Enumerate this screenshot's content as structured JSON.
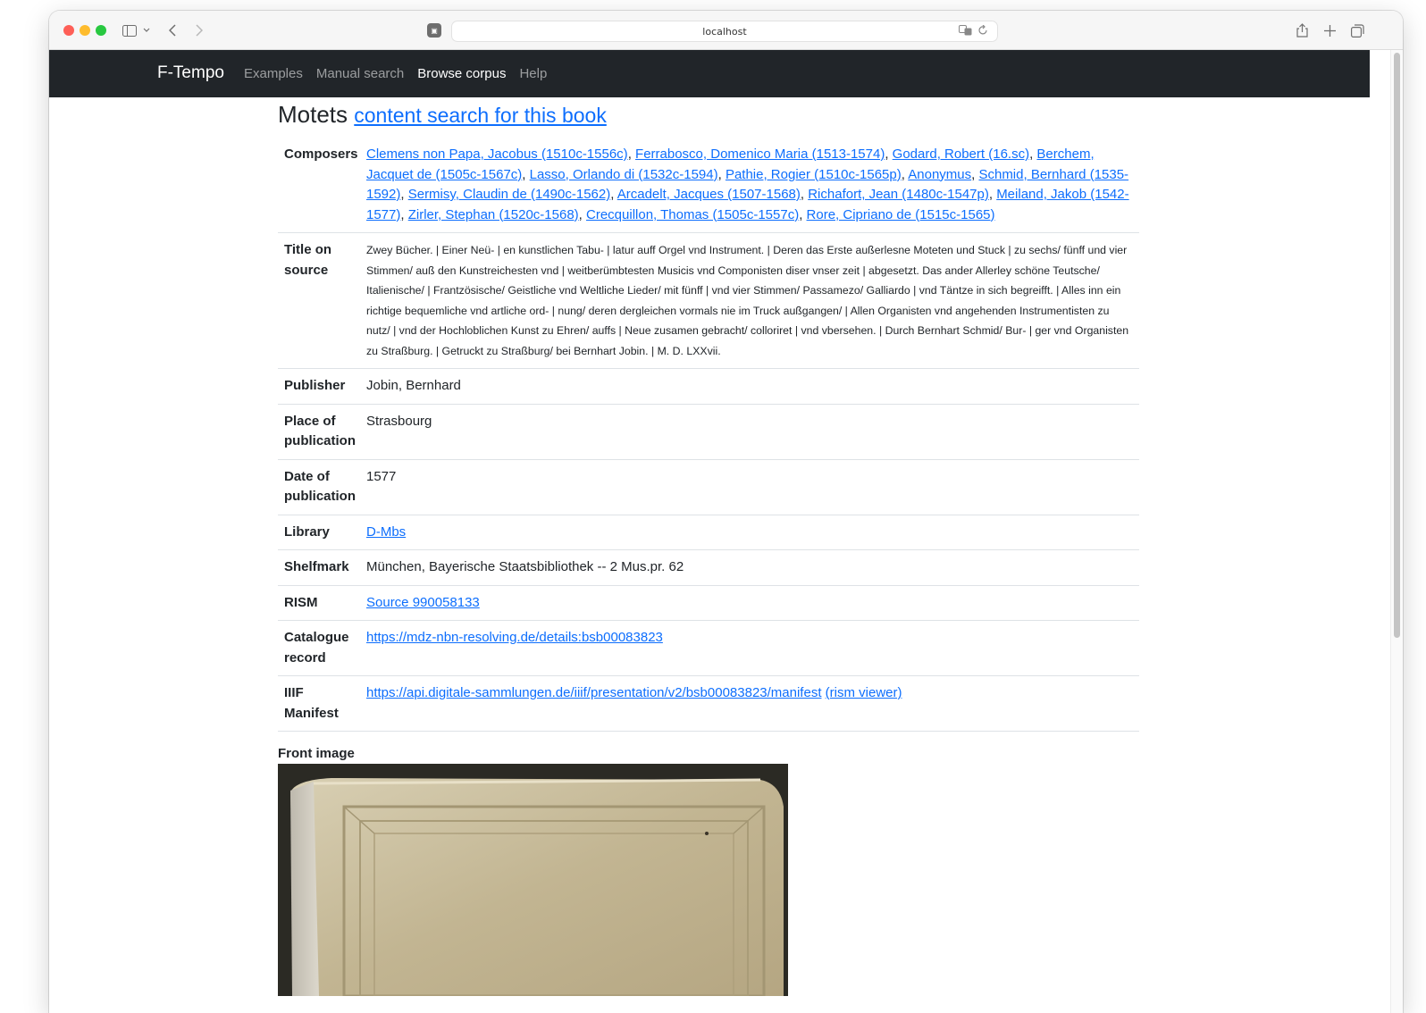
{
  "browser": {
    "address": "localhost"
  },
  "navbar": {
    "brand": "F-Tempo",
    "links": [
      "Examples",
      "Manual search",
      "Browse corpus",
      "Help"
    ]
  },
  "page": {
    "title": "Motets",
    "title_link": "content search for this book"
  },
  "details": {
    "composers_label": "Composers",
    "composers": [
      "Clemens non Papa, Jacobus (1510c-1556c)",
      "Ferrabosco, Domenico Maria (1513-1574)",
      "Godard, Robert (16.sc)",
      "Berchem, Jacquet de (1505c-1567c)",
      "Lasso, Orlando di (1532c-1594)",
      "Pathie, Rogier (1510c-1565p)",
      "Anonymus",
      "Schmid, Bernhard (1535-1592)",
      "Sermisy, Claudin de (1490c-1562)",
      "Arcadelt, Jacques (1507-1568)",
      "Richafort, Jean (1480c-1547p)",
      "Meiland, Jakob (1542-1577)",
      "Zirler, Stephan (1520c-1568)",
      "Crecquillon, Thomas (1505c-1557c)",
      "Rore, Cipriano de (1515c-1565)"
    ],
    "title_on_source_label": "Title on source",
    "title_on_source": "Zwey Bücher. | Einer Neü- | en kunstlichen Tabu- | latur auff Orgel vnd Instrument. | Deren das Erste außerlesne Moteten und Stuck | zu sechs/ fünff und vier Stimmen/ auß den Kunstreichesten vnd | weitberümbtesten Musicis vnd Componisten diser vnser zeit | abgesetzt. Das ander Allerley schöne Teutsche/ Italienische/ | Frantzösische/ Geistliche vnd Weltliche Lieder/ mit fünff | vnd vier Stimmen/ Passamezo/ Galliardo | vnd Täntze in sich begreifft. | Alles inn ein richtige bequemliche vnd artliche ord- | nung/ deren dergleichen vormals nie im Truck außgangen/ | Allen Organisten vnd angehenden Instrumentisten zu nutz/ | vnd der Hochloblichen Kunst zu Ehren/ auffs | Neue zusamen gebracht/ colloriret | vnd vbersehen. | Durch Bernhart Schmid/ Bur- | ger vnd Organisten zu Straßburg. | Getruckt zu Straßburg/ bei Bernhart Jobin. | M. D. LXXvii.",
    "publisher_label": "Publisher",
    "publisher": "Jobin, Bernhard",
    "place_label": "Place of publication",
    "place": "Strasbourg",
    "date_label": "Date of publication",
    "date": "1577",
    "library_label": "Library",
    "library": "D-Mbs",
    "shelfmark_label": "Shelfmark",
    "shelfmark": "München, Bayerische Staatsbibliothek -- 2 Mus.pr. 62",
    "rism_label": "RISM",
    "rism": "Source 990058133",
    "catalogue_label": "Catalogue record",
    "catalogue": "https://mdz-nbn-resolving.de/details:bsb00083823",
    "iiif_label": "IIIF Manifest",
    "iiif": "https://api.digitale-sammlungen.de/iiif/presentation/v2/bsb00083823/manifest",
    "iiif_viewer": "(rism viewer)"
  },
  "front_image_label": "Front image",
  "colors": {
    "navbar_bg": "#212529",
    "link": "#0d6efd",
    "book_cover": "#c9bd9a"
  }
}
